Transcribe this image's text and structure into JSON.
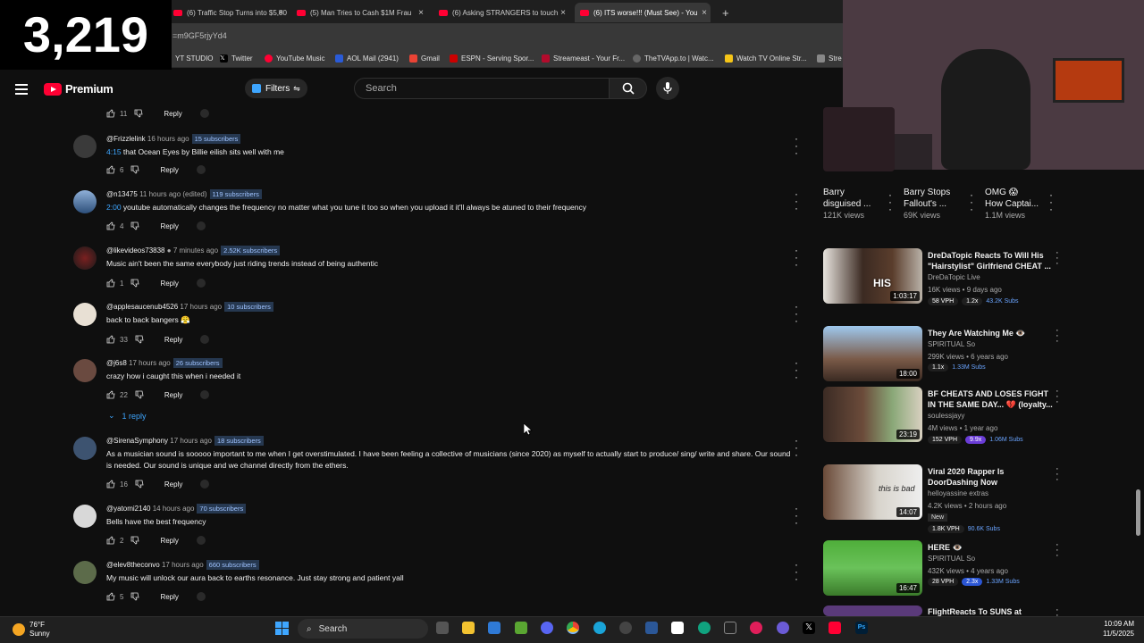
{
  "counter": "3,219",
  "tabs": [
    {
      "label": "(6) Traffic Stop Turns into $5,00"
    },
    {
      "label": "(5) Man Tries to Cash $1M Frau"
    },
    {
      "label": "(6) Asking STRANGERS to touch"
    },
    {
      "label": "(6) ITS worse!!! (Must See) - You"
    }
  ],
  "address": {
    "url": "=m9GF5rjyYd4"
  },
  "bookmarks": [
    "YT STUDIO",
    "Twitter",
    "YouTube Music",
    "AOL Mail (2941)",
    "Gmail",
    "ESPN - Serving Spor...",
    "Streameast - Your Fr...",
    "TheTVApp.to | Watc...",
    "Watch TV Online Str...",
    "Stre"
  ],
  "header": {
    "brand": "Premium",
    "filters": "Filters",
    "search_placeholder": "Search"
  },
  "top_row": {
    "likes": "11",
    "reply": "Reply"
  },
  "comments": [
    {
      "user": "@Frizzlelink",
      "time": "16 hours ago",
      "subs": "15 subscribers",
      "ts": "4:15",
      "text": " that Ocean Eyes by Billie eilish sits well with me",
      "likes": "6",
      "reply": "Reply"
    },
    {
      "user": "@n13475",
      "time": "11 hours ago (edited)",
      "subs": "119 subscribers",
      "ts": "2:00",
      "text": " youtube automatically changes the frequency no matter what you tune it too so when you upload it it'll always be atuned to their frequency",
      "likes": "4",
      "reply": "Reply"
    },
    {
      "user": "@likevideos73838",
      "time": "7 minutes ago",
      "subs": "2.52K subscribers",
      "ts": "",
      "text": "Music ain't been the same everybody just riding trends instead of being authentic",
      "likes": "1",
      "reply": "Reply"
    },
    {
      "user": "@applesaucenub4526",
      "time": "17 hours ago",
      "subs": "10 subscribers",
      "ts": "",
      "text": "back to back bangers 😤",
      "likes": "33",
      "reply": "Reply"
    },
    {
      "user": "@j6s8",
      "time": "17 hours ago",
      "subs": "26 subscribers",
      "ts": "",
      "text": "crazy how i caught this when i needed it",
      "likes": "22",
      "reply": "Reply",
      "replies": "1 reply"
    },
    {
      "user": "@SirenaSymphony",
      "time": "17 hours ago",
      "subs": "18 subscribers",
      "ts": "",
      "text": "As a musician sound is sooooo important to me when I get overstimulated. I have been feeling a collective of musicians (since 2020) as myself to actually start to produce/ sing/ write and share. Our sound is needed. Our sound is unique and we channel directly from the ethers.",
      "likes": "16",
      "reply": "Reply"
    },
    {
      "user": "@yatomi2140",
      "time": "14 hours ago",
      "subs": "70 subscribers",
      "ts": "",
      "text": "Bells have the best frequency",
      "likes": "2",
      "reply": "Reply"
    },
    {
      "user": "@elev8theconvo",
      "time": "17 hours ago",
      "subs": "660 subscribers",
      "ts": "",
      "text": "My music will unlock our aura back to earths resonance. Just stay strong and patient yall",
      "likes": "5",
      "reply": "Reply"
    }
  ],
  "top_cards": [
    {
      "title1": "Barry",
      "title2": "disguised ...",
      "views": "121K views"
    },
    {
      "title1": "Barry Stops",
      "title2": "Fallout's ...",
      "views": "69K views"
    },
    {
      "title1": "OMG 😱",
      "title2": "How Captai...",
      "views": "1.1M views"
    }
  ],
  "recs": [
    {
      "title": "DreDaTopic Reacts To Will His \"Hairstylist\" Girlfriend CHEAT ...",
      "channel": "DreDaTopic Live",
      "meta": "16K views • 9 days ago",
      "duration": "1:03:17",
      "vph": "58 VPH",
      "mult": "1.2x",
      "subs": "43.2K Subs",
      "mult_style": ""
    },
    {
      "title": "They Are Watching Me 👁️",
      "channel": "SPIRITUAL So",
      "meta": "299K views • 6 years ago",
      "duration": "18:00",
      "vph": "1.1x",
      "mult": "",
      "subs": "1.33M Subs",
      "mult_style": ""
    },
    {
      "title": "BF CHEATS AND LOSES FIGHT IN THE SAME DAY... 💔 (loyalty...",
      "channel": "soulessjayy",
      "meta": "4M views • 1 year ago",
      "duration": "23:19",
      "vph": "152 VPH",
      "mult": "9.9x",
      "subs": "1.06M Subs",
      "mult_style": "purple"
    },
    {
      "title": "Viral 2020 Rapper Is DoorDashing Now",
      "channel": "helloyassine extras",
      "meta": "4.2K views • 2 hours ago",
      "duration": "14:07",
      "vph": "1.8K VPH",
      "mult": "",
      "subs": "90.6K Subs",
      "new": "New",
      "mult_style": ""
    },
    {
      "title": "HERE 👁️",
      "channel": "SPIRITUAL So",
      "meta": "432K views • 4 years ago",
      "duration": "16:47",
      "vph": "28 VPH",
      "mult": "2.3x",
      "subs": "1.33M Subs",
      "mult_style": "blue"
    },
    {
      "title": "FlightReacts To SUNS at",
      "channel": "",
      "meta": "",
      "duration": "",
      "vph": "",
      "mult": "",
      "subs": "",
      "mult_style": ""
    }
  ],
  "thumb_text": {
    "his": "HIS",
    "bad": "this is bad"
  },
  "taskbar": {
    "temp": "76°F",
    "condition": "Sunny",
    "search": "Search",
    "time": "10:09 AM",
    "date": "11/5/2025"
  }
}
